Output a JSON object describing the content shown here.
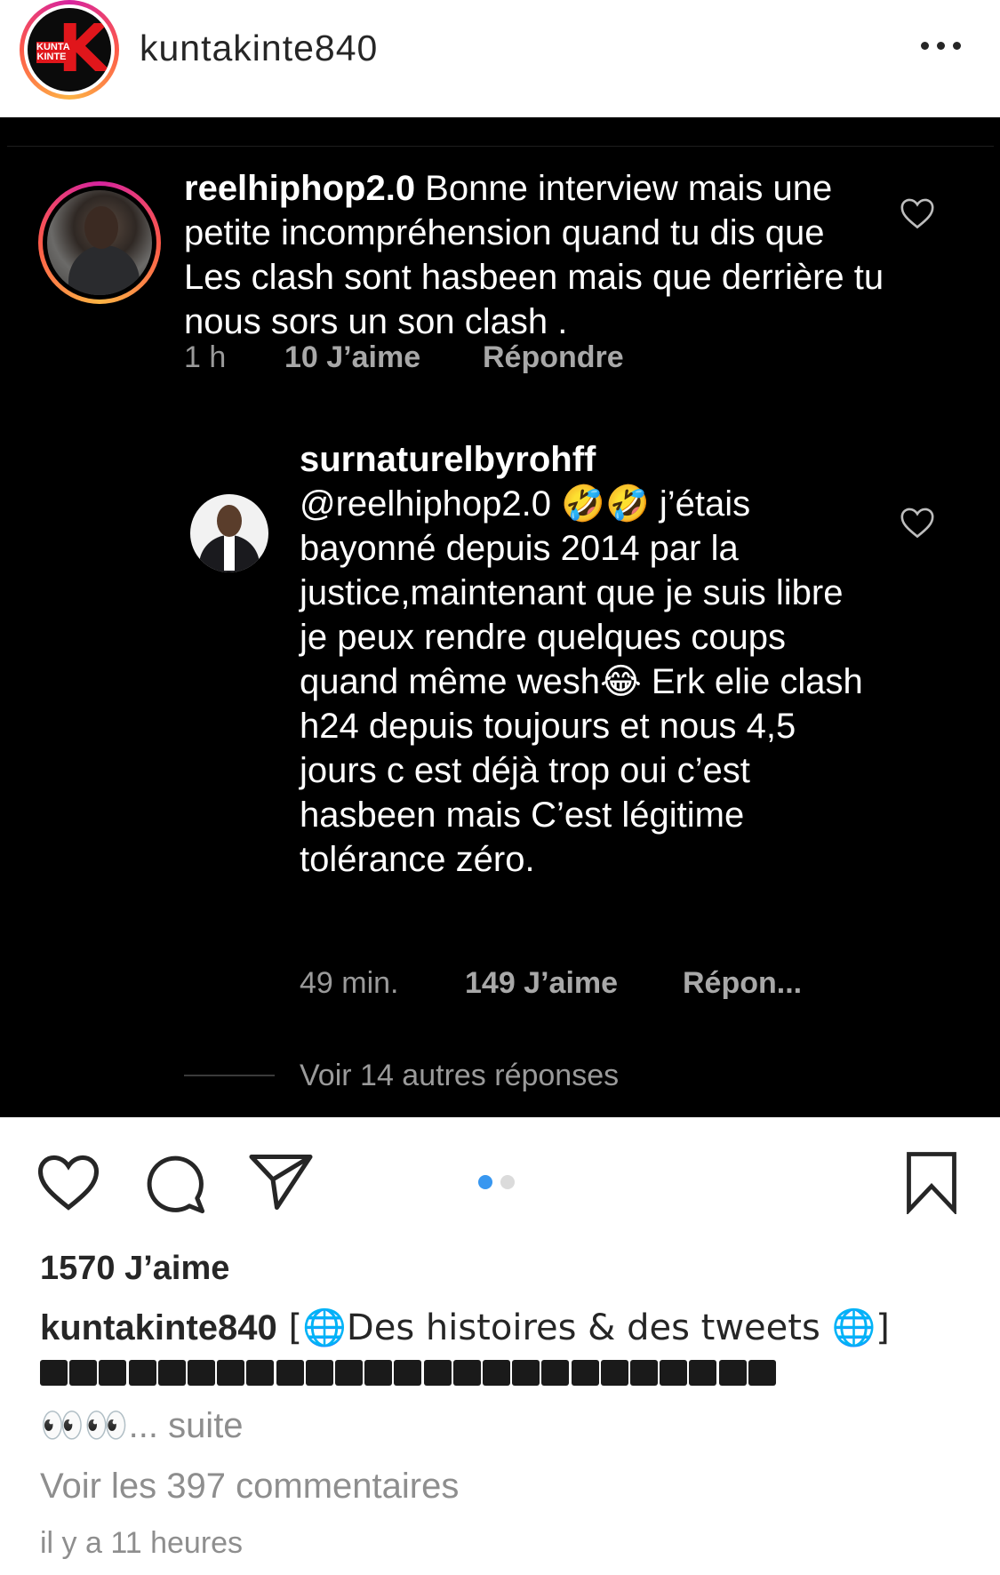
{
  "header": {
    "username": "kuntakinte840",
    "avatar_logo_text": "KUNTA KINTE",
    "avatar_logo_letter": "K"
  },
  "post_image": {
    "comment1": {
      "username": "reelhiphop2.0",
      "text": " Bonne interview mais une petite incompréhension quand tu dis que Les clash sont hasbeen mais que derrière tu nous sors un son clash .",
      "time": "1 h",
      "likes": "10 J’aime",
      "reply": "Répondre"
    },
    "comment2": {
      "username": "surnaturelbyrohff",
      "text": "@reelhiphop2.0 🤣🤣 j’étais bayonné depuis 2014 par la justice,maintenant que je suis libre je peux rendre quelques coups quand même wesh😂 Erk elie clash h24 depuis toujours et nous 4,5 jours c est déjà trop oui c’est hasbeen mais C’est légitime tolérance zéro.",
      "time": "49 min.",
      "likes": "149 J’aime",
      "reply": "Répon..."
    },
    "view_more_replies": "Voir 14 autres réponses"
  },
  "actions": {
    "like_icon": "heart-icon",
    "comment_icon": "comment-icon",
    "share_icon": "paper-plane-icon",
    "save_icon": "bookmark-icon",
    "carousel_active": 1,
    "carousel_total": 2,
    "accent": "#3897f0"
  },
  "post": {
    "likes": "1570 J’aime",
    "caption_user": "kuntakinte840",
    "caption_text": " [🌐Des histoires & des tweets 🌐]",
    "eyes": "👀👀",
    "more": "... suite",
    "view_comments": "Voir les 397 commentaires",
    "time_ago": "il y a 11 heures"
  }
}
